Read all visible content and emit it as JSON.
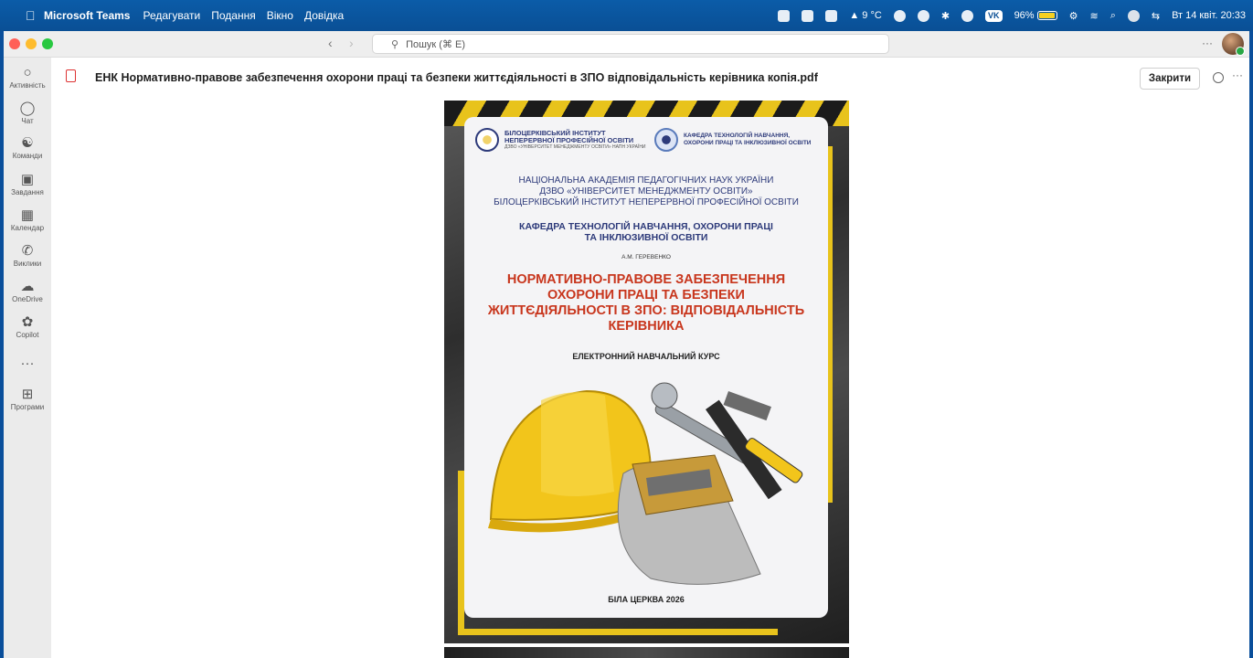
{
  "menubar": {
    "app_name": "Microsoft Teams",
    "items": [
      "Редагувати",
      "Подання",
      "Вікно",
      "Довідка"
    ],
    "weather": "9 °C",
    "vk": "VK",
    "battery": "96%",
    "battery_level": 0.96,
    "datetime": "Вт 14 квіт. 20:33"
  },
  "window": {
    "search_placeholder": "Пошук (⌘ E)"
  },
  "rail": {
    "items": [
      {
        "label": "Активність",
        "icon": "bell-icon"
      },
      {
        "label": "Чат",
        "icon": "chat-icon"
      },
      {
        "label": "Команди",
        "icon": "teams-icon"
      },
      {
        "label": "Завдання",
        "icon": "assignments-icon"
      },
      {
        "label": "Календар",
        "icon": "calendar-icon"
      },
      {
        "label": "Виклики",
        "icon": "phone-icon"
      },
      {
        "label": "OneDrive",
        "icon": "cloud-icon"
      },
      {
        "label": "Copilot",
        "icon": "copilot-icon"
      },
      {
        "label": "",
        "icon": "more-icon"
      },
      {
        "label": "Програми",
        "icon": "add-app-icon"
      }
    ]
  },
  "file": {
    "title": "ЕНК Нормативно-правове забезпечення охорони праці та безпеки життєдіяльності в ЗПО відповідальність керівника копія.pdf",
    "close_label": "Закрити"
  },
  "document": {
    "logo_left_name": "БІЛОЦЕРКІВСЬКИЙ ІНСТИТУТ НЕПЕРЕРВНОЇ ПРОФЕСІЙНОЇ ОСВІТИ",
    "logo_left_sub": "ДЗВО «УНІВЕРСИТЕТ МЕНЕДЖМЕНТУ ОСВІТИ» НАПН УКРАЇНИ",
    "logo_right_name": "КАФЕДРА ТЕХНОЛОГІЙ НАВЧАННЯ, ОХОРОНИ ПРАЦІ ТА ІНКЛЮЗИВНОЇ ОСВІТИ",
    "academy_line1": "НАЦІОНАЛЬНА АКАДЕМІЯ ПЕДАГОГІЧНИХ НАУК УКРАЇНИ",
    "academy_line2": "ДЗВО «УНІВЕРСИТЕТ МЕНЕДЖМЕНТУ ОСВІТИ»",
    "academy_line3": "БІЛОЦЕРКІВСЬКИЙ ІНСТИТУТ НЕПЕРЕРВНОЇ ПРОФЕСІЙНОЇ ОСВІТИ",
    "dept_line1": "КАФЕДРА ТЕХНОЛОГІЙ НАВЧАННЯ, ОХОРОНИ ПРАЦІ",
    "dept_line2": "ТА ІНКЛЮЗИВНОЇ ОСВІТИ",
    "author": "А.М. ГЕРЕВЕНКО",
    "title_line1": "НОРМАТИВНО-ПРАВОВЕ ЗАБЕЗПЕЧЕННЯ",
    "title_line2": "ОХОРОНИ ПРАЦІ ТА БЕЗПЕКИ",
    "title_line3": "ЖИТТЄДІЯЛЬНОСТІ В ЗПО: ВІДПОВІДАЛЬНІСТЬ",
    "title_line4": "КЕРІВНИКА",
    "course_type": "ЕЛЕКТРОННИЙ НАВЧАЛЬНИЙ КУРС",
    "city_year": "БІЛА ЦЕРКВА 2026"
  },
  "colors": {
    "menubar": "#0a4f95",
    "title_red": "#c8361d",
    "navy": "#2d3a7a",
    "hazard_yellow": "#e8c31c"
  }
}
